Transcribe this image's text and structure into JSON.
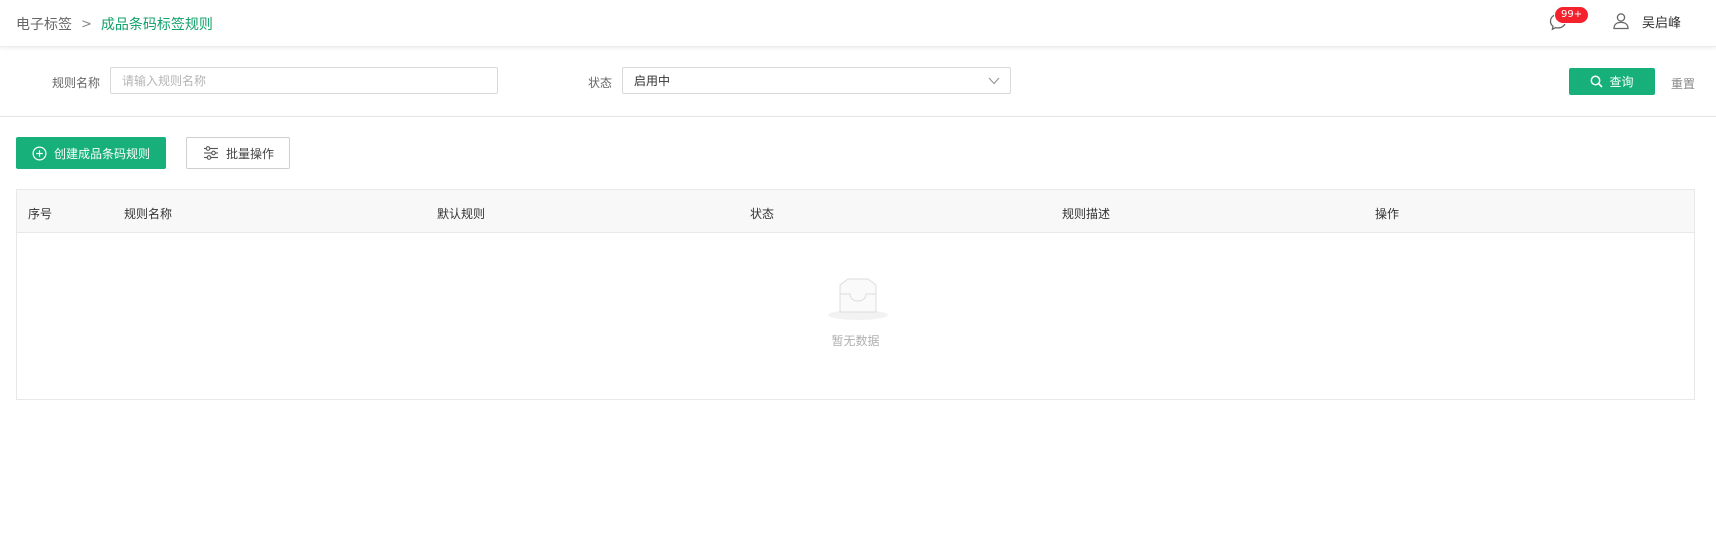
{
  "header": {
    "breadcrumb": {
      "parent": "电子标签",
      "separator": ">",
      "current": "成品条码标签规则"
    },
    "notifications": {
      "badge": "99+",
      "icon": "message-icon"
    },
    "user": {
      "name": "吴启峰",
      "icon": "user-icon"
    }
  },
  "filters": {
    "rule_name": {
      "label": "规则名称",
      "placeholder": "请输入规则名称",
      "value": ""
    },
    "status": {
      "label": "状态",
      "value": "启用中"
    },
    "query_label": "查询",
    "reset_label": "重置"
  },
  "actions": {
    "create_label": "创建成品条码规则",
    "batch_label": "批量操作"
  },
  "table": {
    "columns": [
      "序号",
      "规则名称",
      "默认规则",
      "状态",
      "规则描述",
      "操作"
    ],
    "rows": [],
    "empty_text": "暂无数据"
  },
  "colors": {
    "accent": "#17b07b",
    "breadcrumb_active": "#12a26a",
    "badge": "#f5222d"
  }
}
